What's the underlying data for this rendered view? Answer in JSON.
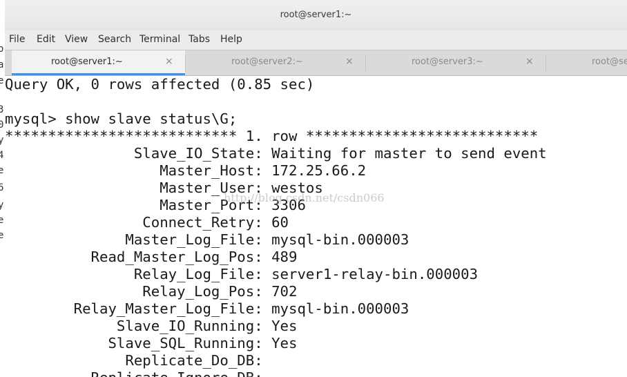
{
  "background_window": {
    "visible_chars": [
      "o",
      "a",
      "e",
      "3",
      "0",
      "y",
      "4",
      "e",
      "6",
      "y",
      "e",
      "e"
    ]
  },
  "window": {
    "title": "root@server1:~"
  },
  "menu": {
    "items": [
      "File",
      "Edit",
      "View",
      "Search",
      "Terminal",
      "Tabs",
      "Help"
    ]
  },
  "tabs": [
    {
      "label": "root@server1:~",
      "active": true
    },
    {
      "label": "root@server2:~",
      "active": false
    },
    {
      "label": "root@server3:~",
      "active": false
    },
    {
      "label": "root@se",
      "active": false
    }
  ],
  "tab_close_glyph": "×",
  "terminal": {
    "lines": [
      "Query OK, 0 rows affected (0.85 sec)",
      "",
      "mysql> show slave status\\G;",
      "*************************** 1. row ***************************",
      "               Slave_IO_State: Waiting for master to send event",
      "                  Master_Host: 172.25.66.2",
      "                  Master_User: westos",
      "                  Master_Port: 3306",
      "                Connect_Retry: 60",
      "              Master_Log_File: mysql-bin.000003",
      "          Read_Master_Log_Pos: 489",
      "               Relay_Log_File: server1-relay-bin.000003",
      "                Relay_Log_Pos: 702",
      "        Relay_Master_Log_File: mysql-bin.000003",
      "             Slave_IO_Running: Yes",
      "            Slave_SQL_Running: Yes",
      "              Replicate_Do_DB: ",
      "          Replicate_Ignore_DB: "
    ]
  },
  "watermark": "http://blog.csdn.net/csdn066"
}
